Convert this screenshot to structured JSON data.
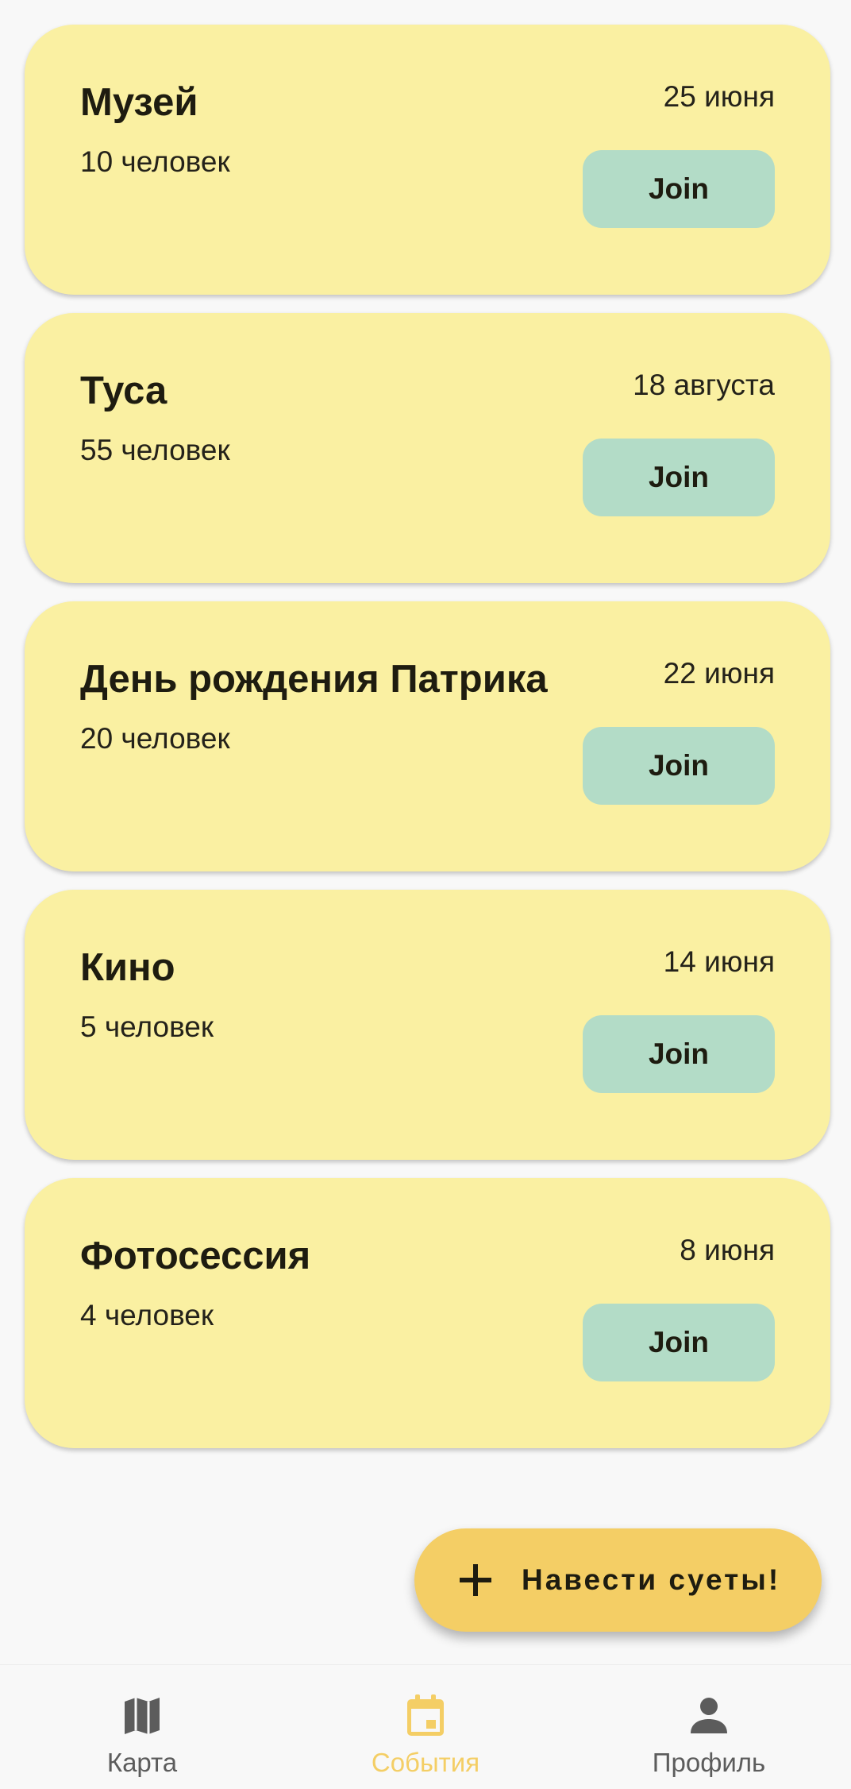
{
  "events": [
    {
      "title": "Музей",
      "count": "10 человек",
      "date": "25 июня",
      "join_label": "Join"
    },
    {
      "title": "Туса",
      "count": "55 человек",
      "date": "18 августа",
      "join_label": "Join"
    },
    {
      "title": "День рождения Патрика",
      "count": "20 человек",
      "date": "22 июня",
      "join_label": "Join"
    },
    {
      "title": "Кино",
      "count": "5 человек",
      "date": "14 июня",
      "join_label": "Join"
    },
    {
      "title": "Фотосессия",
      "count": "4 человек",
      "date": "8 июня",
      "join_label": "Join"
    }
  ],
  "fab": {
    "label": "Навести суеты!",
    "icon": "plus-icon"
  },
  "bottom_nav": {
    "items": [
      {
        "label": "Карта",
        "icon": "map-icon",
        "active": false
      },
      {
        "label": "События",
        "icon": "calendar-icon",
        "active": true
      },
      {
        "label": "Профиль",
        "icon": "person-icon",
        "active": false
      }
    ]
  },
  "colors": {
    "background": "#F8F8F8",
    "card": "#FAF0A2",
    "join_button": "#B3DCC7",
    "accent": "#F4CE65",
    "text": "#1E1C10",
    "nav_inactive": "#5C5C5C"
  }
}
